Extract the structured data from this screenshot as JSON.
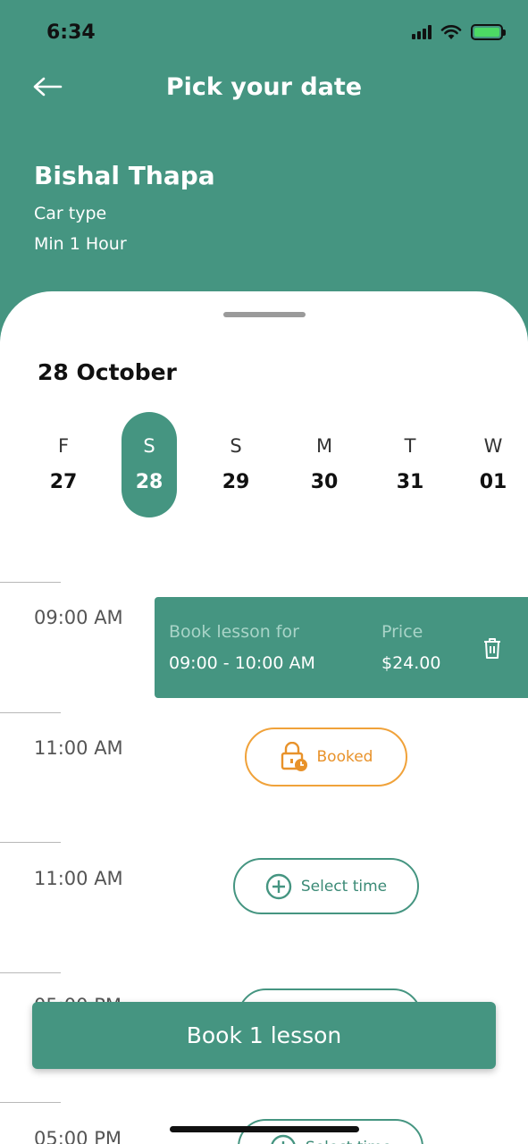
{
  "status_bar": {
    "time": "6:34"
  },
  "header": {
    "title": "Pick your date",
    "instructor_name": "Bishal Thapa",
    "car_type": "Car type",
    "min_duration": "Min 1 Hour"
  },
  "calendar": {
    "month_label": "28 October",
    "selected_index": 1,
    "days": [
      {
        "dow": "F",
        "num": "27"
      },
      {
        "dow": "S",
        "num": "28"
      },
      {
        "dow": "S",
        "num": "29"
      },
      {
        "dow": "M",
        "num": "30"
      },
      {
        "dow": "T",
        "num": "31"
      },
      {
        "dow": "W",
        "num": "01"
      }
    ]
  },
  "slots": [
    {
      "time": "09:00 AM",
      "state": "booked-by-you"
    },
    {
      "time": "11:00 AM",
      "state": "booked"
    },
    {
      "time": "11:00 AM",
      "state": "available"
    },
    {
      "time": "05:00 PM",
      "state": "available"
    },
    {
      "time": "05:00 PM",
      "state": "available"
    }
  ],
  "booking_card": {
    "label_left": "Book lesson for",
    "value_left": "09:00 - 10:00 AM",
    "label_right": "Price",
    "value_right": "$24.00"
  },
  "booked_label": "Booked",
  "select_time_label": "Select time",
  "book_button_label": "Book 1 lesson",
  "colors": {
    "primary": "#459581",
    "booked": "#f0a23a",
    "white": "#ffffff"
  }
}
